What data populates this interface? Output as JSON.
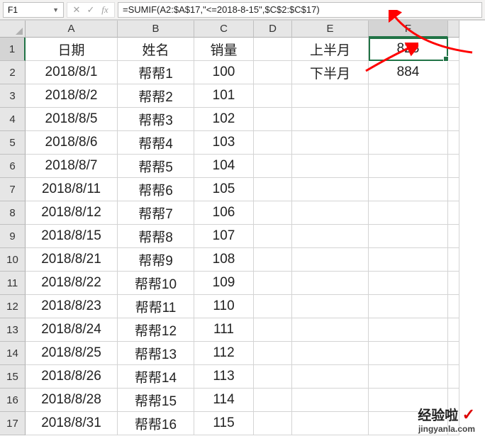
{
  "name_box": "F1",
  "formula": "=SUMIF(A2:$A$17,\"<=2018-8-15\",$C$2:$C$17)",
  "columns": [
    "A",
    "B",
    "C",
    "D",
    "E",
    "F"
  ],
  "active_col": "F",
  "active_row": 1,
  "rows": [
    {
      "n": 1,
      "A": "日期",
      "B": "姓名",
      "C": "销量",
      "D": "",
      "E": "上半月",
      "F": "828"
    },
    {
      "n": 2,
      "A": "2018/8/1",
      "B": "帮帮1",
      "C": "100",
      "D": "",
      "E": "下半月",
      "F": "884"
    },
    {
      "n": 3,
      "A": "2018/8/2",
      "B": "帮帮2",
      "C": "101",
      "D": "",
      "E": "",
      "F": ""
    },
    {
      "n": 4,
      "A": "2018/8/5",
      "B": "帮帮3",
      "C": "102",
      "D": "",
      "E": "",
      "F": ""
    },
    {
      "n": 5,
      "A": "2018/8/6",
      "B": "帮帮4",
      "C": "103",
      "D": "",
      "E": "",
      "F": ""
    },
    {
      "n": 6,
      "A": "2018/8/7",
      "B": "帮帮5",
      "C": "104",
      "D": "",
      "E": "",
      "F": ""
    },
    {
      "n": 7,
      "A": "2018/8/11",
      "B": "帮帮6",
      "C": "105",
      "D": "",
      "E": "",
      "F": ""
    },
    {
      "n": 8,
      "A": "2018/8/12",
      "B": "帮帮7",
      "C": "106",
      "D": "",
      "E": "",
      "F": ""
    },
    {
      "n": 9,
      "A": "2018/8/15",
      "B": "帮帮8",
      "C": "107",
      "D": "",
      "E": "",
      "F": ""
    },
    {
      "n": 10,
      "A": "2018/8/21",
      "B": "帮帮9",
      "C": "108",
      "D": "",
      "E": "",
      "F": ""
    },
    {
      "n": 11,
      "A": "2018/8/22",
      "B": "帮帮10",
      "C": "109",
      "D": "",
      "E": "",
      "F": ""
    },
    {
      "n": 12,
      "A": "2018/8/23",
      "B": "帮帮11",
      "C": "110",
      "D": "",
      "E": "",
      "F": ""
    },
    {
      "n": 13,
      "A": "2018/8/24",
      "B": "帮帮12",
      "C": "111",
      "D": "",
      "E": "",
      "F": ""
    },
    {
      "n": 14,
      "A": "2018/8/25",
      "B": "帮帮13",
      "C": "112",
      "D": "",
      "E": "",
      "F": ""
    },
    {
      "n": 15,
      "A": "2018/8/26",
      "B": "帮帮14",
      "C": "113",
      "D": "",
      "E": "",
      "F": ""
    },
    {
      "n": 16,
      "A": "2018/8/28",
      "B": "帮帮15",
      "C": "114",
      "D": "",
      "E": "",
      "F": ""
    },
    {
      "n": 17,
      "A": "2018/8/31",
      "B": "帮帮16",
      "C": "115",
      "D": "",
      "E": "",
      "F": ""
    }
  ],
  "watermark": {
    "line1": "经验啦",
    "check": "✓",
    "line2": "jingyanla.com"
  }
}
